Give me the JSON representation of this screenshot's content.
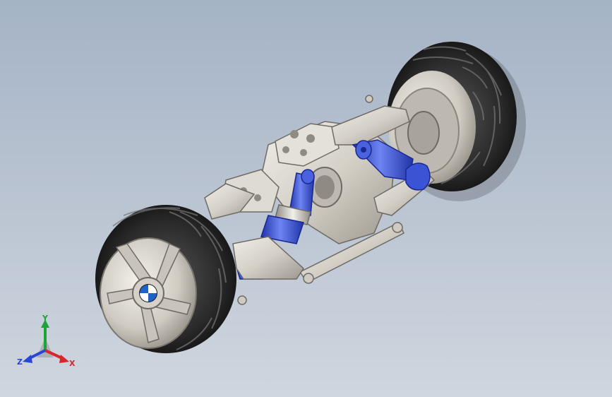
{
  "viewport": {
    "background_top": "#a5b3c6",
    "background_bottom": "#cfd6df"
  },
  "model": {
    "metal_color": "#d9d6cf",
    "metal_dark": "#8f8b84",
    "accent_color": "#3b54d6",
    "tire_color": "#2a2a2a",
    "hub_badge_colors": [
      "#1e63c9",
      "#ffffff"
    ]
  },
  "triad": {
    "x_label": "X",
    "y_label": "Y",
    "z_label": "Z",
    "x_color": "#d8262a",
    "y_color": "#1ea33a",
    "z_color": "#2a46d6"
  }
}
